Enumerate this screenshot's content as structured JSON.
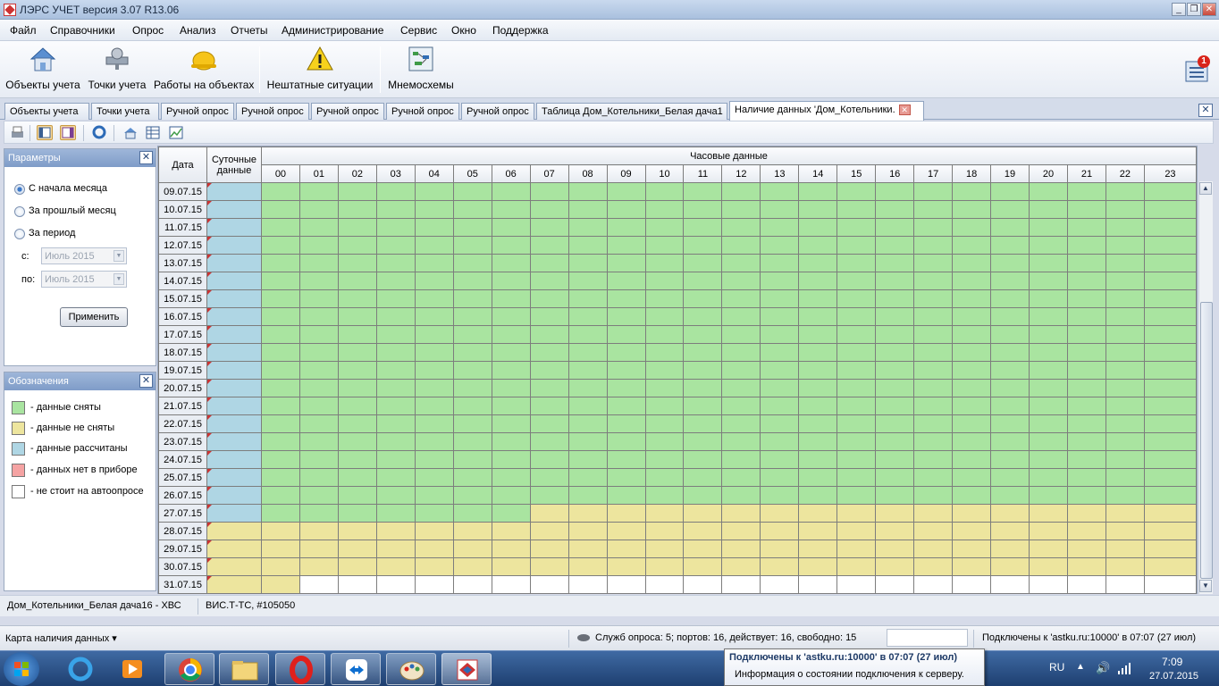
{
  "window": {
    "title": "ЛЭРС УЧЕТ версия 3.07 R13.06",
    "min": "_",
    "max": "❐",
    "close": "✕"
  },
  "menu": [
    "Файл",
    "Справочники",
    "Опрос",
    "Анализ",
    "Отчеты",
    "Администрирование",
    "Сервис",
    "Окно",
    "Поддержка"
  ],
  "toolbar": {
    "objects": "Объекты учета",
    "points": "Точки учета",
    "works": "Работы на объектах",
    "emergency": "Нештатные ситуации",
    "schemes": "Мнемосхемы",
    "notifications_count": "1"
  },
  "tabs": [
    "Объекты учета",
    "Точки учета",
    "Ручной опрос",
    "Ручной опрос",
    "Ручной опрос",
    "Ручной опрос",
    "Ручной опрос",
    "Таблица Дом_Котельники_Белая дача1",
    "Наличие данных 'Дом_Котельники."
  ],
  "params": {
    "title": "Параметры",
    "r1": "С начала месяца",
    "r2": "За прошлый месяц",
    "r3": "За период",
    "from_label": "с:",
    "to_label": "по:",
    "from_value": "Июль 2015",
    "to_value": "Июль 2015",
    "apply": "Применить"
  },
  "legend": {
    "title": "Обозначения",
    "items": [
      "- данные сняты",
      "- данные не сняты",
      "- данные рассчитаны",
      "- данных нет в приборе",
      "- не стоит на автоопросе"
    ],
    "colors": [
      "#a9e4a0",
      "#ede59e",
      "#afd6e4",
      "#f5a3a3",
      "#ffffff"
    ]
  },
  "grid": {
    "col_date": "Дата",
    "col_daily": "Суточные данные",
    "col_hourly": "Часовые данные",
    "hours": [
      "00",
      "01",
      "02",
      "03",
      "04",
      "05",
      "06",
      "07",
      "08",
      "09",
      "10",
      "11",
      "12",
      "13",
      "14",
      "15",
      "16",
      "17",
      "18",
      "19",
      "20",
      "21",
      "22",
      "23"
    ],
    "rows": [
      {
        "date": "09.07.15",
        "daily": "b",
        "hours": "gggggggggggggggggggggggg"
      },
      {
        "date": "10.07.15",
        "daily": "b",
        "hours": "gggggggggggggggggggggggg"
      },
      {
        "date": "11.07.15",
        "daily": "b",
        "hours": "gggggggggggggggggggggggg"
      },
      {
        "date": "12.07.15",
        "daily": "b",
        "hours": "gggggggggggggggggggggggg"
      },
      {
        "date": "13.07.15",
        "daily": "b",
        "hours": "gggggggggggggggggggggggg"
      },
      {
        "date": "14.07.15",
        "daily": "b",
        "hours": "gggggggggggggggggggggggg"
      },
      {
        "date": "15.07.15",
        "daily": "b",
        "hours": "gggggggggggggggggggggggg"
      },
      {
        "date": "16.07.15",
        "daily": "b",
        "hours": "gggggggggggggggggggggggg"
      },
      {
        "date": "17.07.15",
        "daily": "b",
        "hours": "gggggggggggggggggggggggg"
      },
      {
        "date": "18.07.15",
        "daily": "b",
        "hours": "gggggggggggggggggggggggg"
      },
      {
        "date": "19.07.15",
        "daily": "b",
        "hours": "gggggggggggggggggggggggg"
      },
      {
        "date": "20.07.15",
        "daily": "b",
        "hours": "gggggggggggggggggggggggg"
      },
      {
        "date": "21.07.15",
        "daily": "b",
        "hours": "gggggggggggggggggggggggg"
      },
      {
        "date": "22.07.15",
        "daily": "b",
        "hours": "gggggggggggggggggggggggg"
      },
      {
        "date": "23.07.15",
        "daily": "b",
        "hours": "gggggggggggggggggggggggg"
      },
      {
        "date": "24.07.15",
        "daily": "b",
        "hours": "gggggggggggggggggggggggg"
      },
      {
        "date": "25.07.15",
        "daily": "b",
        "hours": "gggggggggggggggggggggggg"
      },
      {
        "date": "26.07.15",
        "daily": "b",
        "hours": "gggggggggggggggggggggggg"
      },
      {
        "date": "27.07.15",
        "daily": "b",
        "hours": "gggggggyyyyyyyyyyyyyyyyy"
      },
      {
        "date": "28.07.15",
        "daily": "y",
        "hours": "yyyyyyyyyyyyyyyyyyyyyyyy"
      },
      {
        "date": "29.07.15",
        "daily": "y",
        "hours": "yyyyyyyyyyyyyyyyyyyyyyyy"
      },
      {
        "date": "30.07.15",
        "daily": "y",
        "hours": "yyyyyyyyyyyyyyyyyyyyyyyy"
      },
      {
        "date": "31.07.15",
        "daily": "y",
        "hours": "ywwwwwwwwwwwwwwwwwwwwwww"
      }
    ]
  },
  "infobar": {
    "object": "Дом_Котельники_Белая дача16 - ХВС",
    "device": "ВИС.Т-ТС, #105050"
  },
  "statusbar": {
    "map": "Карта наличия данных ▾",
    "service": "Служб опроса: 5; портов: 16, действует: 16, свободно: 15",
    "connected": "Подключены к 'astku.ru:10000' в 07:07 (27 июл)"
  },
  "tooltip": {
    "title": "Подключены к 'astku.ru:10000' в 07:07 (27 июл)",
    "text": "Информация о состоянии подключения к серверу."
  },
  "tray": {
    "lang": "RU",
    "time": "7:09",
    "date": "27.07.2015"
  }
}
